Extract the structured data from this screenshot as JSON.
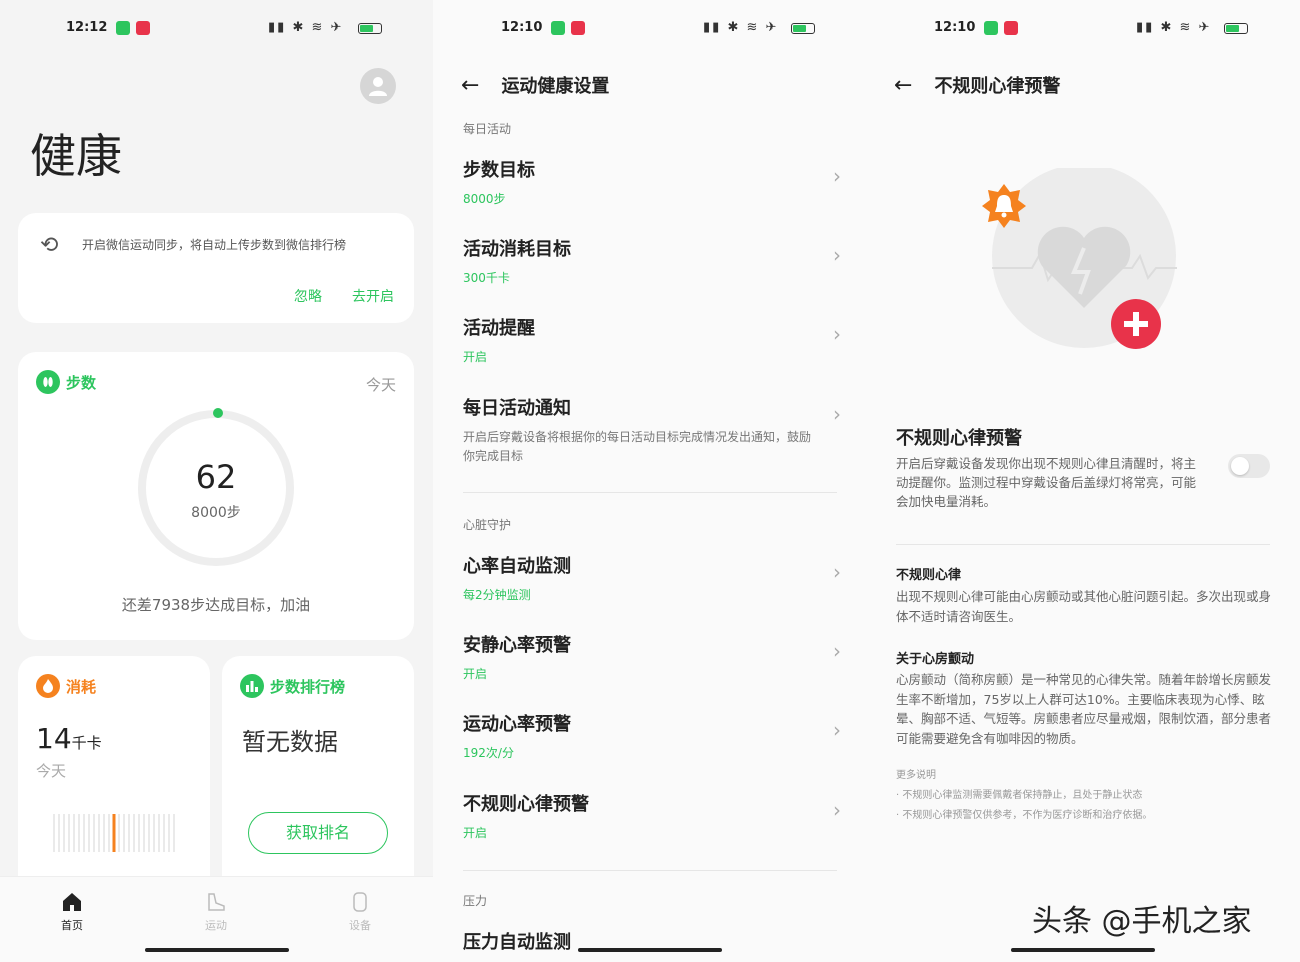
{
  "panel1": {
    "status": {
      "time": "12:12"
    },
    "title": "健康",
    "sync": {
      "text": "开启微信运动同步，将自动上传步数到微信排行榜",
      "ignore": "忽略",
      "enable": "去开启"
    },
    "steps": {
      "label": "步数",
      "today": "今天",
      "count": "62",
      "goal": "8000步",
      "progress": 0.00775,
      "footer": "还差7938步达成目标，加油"
    },
    "calories": {
      "label": "消耗",
      "value": "14",
      "unit": "千卡",
      "sub": "今天"
    },
    "ranking": {
      "label": "步数排行榜",
      "empty": "暂无数据",
      "button": "获取排名"
    },
    "tabs": [
      {
        "label": "首页",
        "icon": "home-icon",
        "active": true
      },
      {
        "label": "运动",
        "icon": "shoe-icon",
        "active": false
      },
      {
        "label": "设备",
        "icon": "watch-icon",
        "active": false
      }
    ]
  },
  "panel2": {
    "status": {
      "time": "12:10"
    },
    "title": "运动健康设置",
    "section_daily": "每日活动",
    "rows": [
      {
        "title": "步数目标",
        "sub": "8000步"
      },
      {
        "title": "活动消耗目标",
        "sub": "300千卡"
      },
      {
        "title": "活动提醒",
        "sub": "开启"
      },
      {
        "title": "每日活动通知",
        "desc": "开启后穿戴设备将根据你的每日活动目标完成情况发出通知，鼓励你完成目标"
      }
    ],
    "section_heart": "心脏守护",
    "heart_rows": [
      {
        "title": "心率自动监测",
        "sub": "每2分钟监测"
      },
      {
        "title": "安静心率预警",
        "sub": "开启"
      },
      {
        "title": "运动心率预警",
        "sub": "192次/分"
      },
      {
        "title": "不规则心律预警",
        "sub": "开启"
      }
    ],
    "section_stress": "压力",
    "stress_row": "压力自动监测"
  },
  "panel3": {
    "status": {
      "time": "12:10"
    },
    "title": "不规则心律预警",
    "setting_title": "不规则心律预警",
    "setting_desc": "开启后穿戴设备发现你出现不规则心律且清醒时，将主动提醒你。监测过程中穿戴设备后盖绿灯将常亮，可能会加快电量消耗。",
    "toggle_on": false,
    "h1": "不规则心律",
    "p1": "出现不规则心律可能由心房颤动或其他心脏问题引起。多次出现或身体不适时请咨询医生。",
    "h2": "关于心房颤动",
    "p2": "心房颤动（简称房颤）是一种常见的心律失常。随着年龄增长房颤发生率不断增加，75岁以上人群可达10%。主要临床表现为心悸、眩晕、胸部不适、气短等。房颤患者应尽量戒烟，限制饮酒，部分患者可能需要避免含有咖啡因的物质。",
    "more_label": "更多说明",
    "more1": "· 不规则心律监测需要佩戴者保持静止，且处于静止状态",
    "more2": "· 不规则心律预警仅供参考，不作为医疗诊断和治疗依据。"
  },
  "watermark": "头条 @手机之家",
  "colors": {
    "accent": "#2dc55e",
    "orange": "#f5821f",
    "red": "#e8334a"
  }
}
